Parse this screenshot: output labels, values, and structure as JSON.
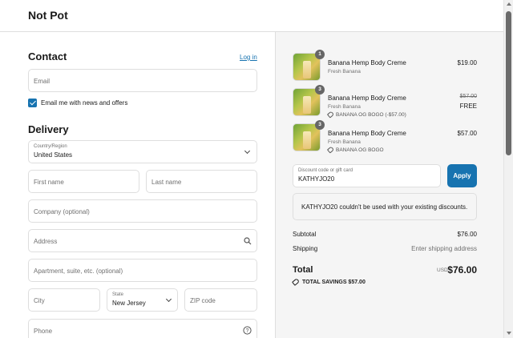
{
  "header": {
    "brand": "Not Pot"
  },
  "contact": {
    "title": "Contact",
    "login_link": "Log in",
    "email_placeholder": "Email",
    "newsletter_label": "Email me with news and offers",
    "newsletter_checked": true
  },
  "delivery": {
    "title": "Delivery",
    "country_label": "Country/Region",
    "country_value": "United States",
    "first_name_placeholder": "First name",
    "last_name_placeholder": "Last name",
    "company_placeholder": "Company (optional)",
    "address_placeholder": "Address",
    "apartment_placeholder": "Apartment, suite, etc. (optional)",
    "city_placeholder": "City",
    "state_label": "State",
    "state_value": "New Jersey",
    "zip_placeholder": "ZIP code",
    "phone_placeholder": "Phone"
  },
  "cart": {
    "items": [
      {
        "qty": "1",
        "name": "Banana Hemp Body Creme",
        "variant": "Fresh Banana",
        "price": "$19.00",
        "discount": "",
        "original_price": ""
      },
      {
        "qty": "3",
        "name": "Banana Hemp Body Creme",
        "variant": "Fresh Banana",
        "price": "FREE",
        "original_price": "$57.00",
        "discount": "BANANA OG BOGO (-$57.00)"
      },
      {
        "qty": "3",
        "name": "Banana Hemp Body Creme",
        "variant": "Fresh Banana",
        "price": "$57.00",
        "discount": "BANANA OG BOGO",
        "original_price": ""
      }
    ]
  },
  "discount": {
    "label": "Discount code or gift card",
    "value": "KATHYJO20",
    "apply_label": "Apply",
    "notice": "KATHYJO20 couldn't be used with your existing discounts."
  },
  "summary": {
    "subtotal_label": "Subtotal",
    "subtotal_value": "$76.00",
    "shipping_label": "Shipping",
    "shipping_value": "Enter shipping address",
    "total_label": "Total",
    "currency": "USD",
    "total_value": "$76.00",
    "savings_text": "TOTAL SAVINGS  $57.00"
  },
  "colors": {
    "accent": "#1773b0",
    "sidebar_bg": "#f5f5f5",
    "border": "#dedede"
  },
  "icons": [
    "search-icon",
    "help-circle-icon",
    "chevron-down-icon",
    "tag-icon",
    "checkmark-icon"
  ]
}
